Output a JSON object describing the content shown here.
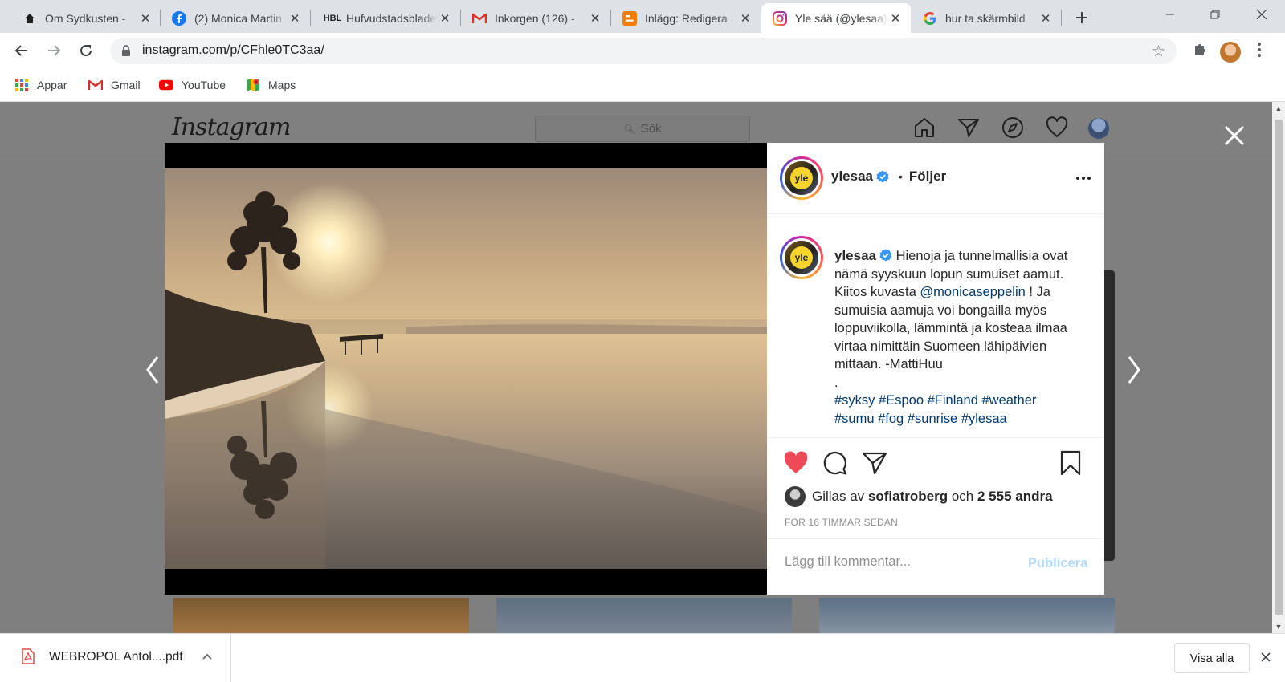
{
  "browser": {
    "tabs": [
      {
        "title": "Om Sydkusten - ",
        "icon": "house-icon"
      },
      {
        "title": "(2) Monica Martin",
        "icon": "facebook-icon"
      },
      {
        "title": "Hufvudstadsbladet",
        "icon": "hbl-icon"
      },
      {
        "title": "Inkorgen (126) - ",
        "icon": "gmail-icon"
      },
      {
        "title": "Inlägg: Redigera",
        "icon": "blogger-icon"
      },
      {
        "title": "Yle sää (@ylesaa)",
        "icon": "instagram-icon"
      },
      {
        "title": "hur ta skärmbild",
        "icon": "google-icon"
      }
    ],
    "active_tab_index": 5,
    "hbl_icon_text": "HBL",
    "url": "instagram.com/p/CFhle0TC3aa/",
    "bookmarks": [
      {
        "label": "Appar",
        "icon": "apps-grid-icon"
      },
      {
        "label": "Gmail",
        "icon": "gmail-icon"
      },
      {
        "label": "YouTube",
        "icon": "youtube-icon"
      },
      {
        "label": "Maps",
        "icon": "maps-icon"
      }
    ]
  },
  "instagram": {
    "logo": "Instagram",
    "search_placeholder": "Sök",
    "post": {
      "username": "ylesaa",
      "avatar_text": "yle",
      "follow_separator": "•",
      "follow_status": "Följer",
      "caption": {
        "username": "ylesaa",
        "text_1": "Hienoja ja tunnelmallisia ovat nämä syyskuun lopun sumuiset aamut. Kiitos kuvasta",
        "mention": "@monicaseppelin",
        "text_2": "! Ja sumuisia aamuja voi bongailla myös loppuviikolla, lämmintä ja kosteaa ilmaa virtaa nimittäin Suomeen lähipäivien mittaan. -MattiHuu",
        "dot": ".",
        "hashtags": [
          "#syksy",
          "#Espoo",
          "#Finland",
          "#weather",
          "#sumu",
          "#fog",
          "#sunrise",
          "#ylesaa"
        ]
      },
      "likes": {
        "prefix": "Gillas av",
        "user": "sofiatroberg",
        "joiner": "och",
        "others": "2 555 andra"
      },
      "timestamp": "FÖR 16 TIMMAR SEDAN",
      "comment_placeholder": "Lägg till kommentar...",
      "publish_label": "Publicera",
      "liked": true
    }
  },
  "downloads": {
    "file_name": "WEBROPOL Antol....pdf",
    "show_all_label": "Visa alla"
  },
  "colors": {
    "like_red": "#ed4956",
    "link_blue": "#00376b",
    "publish_disabled": "#b3dbff",
    "verified_blue": "#3897f0"
  }
}
